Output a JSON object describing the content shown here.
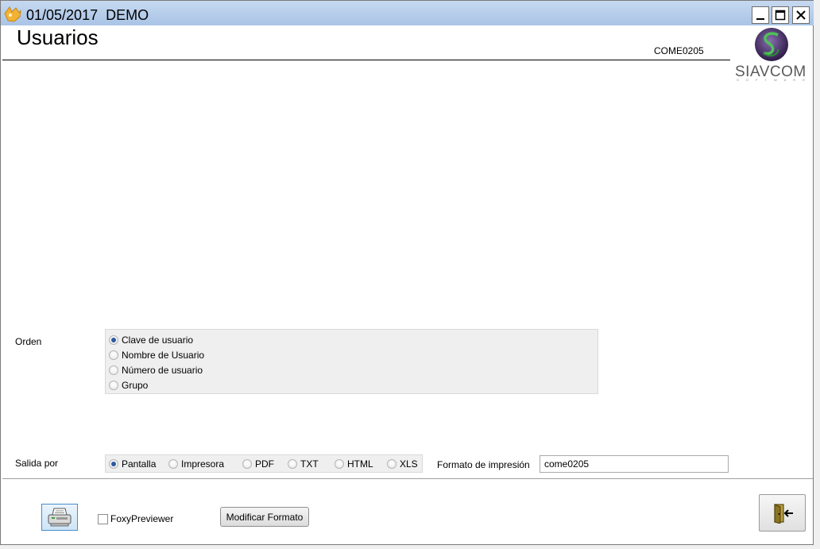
{
  "window": {
    "title_date": "01/05/2017",
    "title_company": "DEMO",
    "controls": {
      "minimize_icon": "minimize-icon",
      "maximize_icon": "maximize-icon",
      "close_icon": "close-icon"
    }
  },
  "header": {
    "page_title": "Usuarios",
    "form_code": "COME0205",
    "logo_text": "SIAVCOM",
    "logo_subtext": "S O F T W A R E"
  },
  "orden": {
    "label": "Orden",
    "options": [
      {
        "label": "Clave de usuario",
        "checked": true
      },
      {
        "label": "Nombre de Usuario",
        "checked": false
      },
      {
        "label": "Número de usuario",
        "checked": false
      },
      {
        "label": "Grupo",
        "checked": false
      }
    ]
  },
  "salida": {
    "label": "Salida por",
    "options": [
      {
        "label": "Pantalla",
        "checked": true
      },
      {
        "label": "Impresora",
        "checked": false
      },
      {
        "label": "PDF",
        "checked": false
      },
      {
        "label": "TXT",
        "checked": false
      },
      {
        "label": "HTML",
        "checked": false
      },
      {
        "label": "XLS",
        "checked": false
      }
    ]
  },
  "formato": {
    "label": "Formato de impresión",
    "value": "come0205"
  },
  "footer": {
    "print_icon": "printer-icon",
    "foxy_label": "FoxyPreviewer",
    "foxy_checked": false,
    "modify_button": "Modificar Formato",
    "exit_icon": "exit-door-icon"
  },
  "colors": {
    "titlebar": "#b8d0ec",
    "radio_selected": "#2c5aa0",
    "logo_green": "#3aa64a",
    "logo_purple": "#4b2a6e"
  }
}
